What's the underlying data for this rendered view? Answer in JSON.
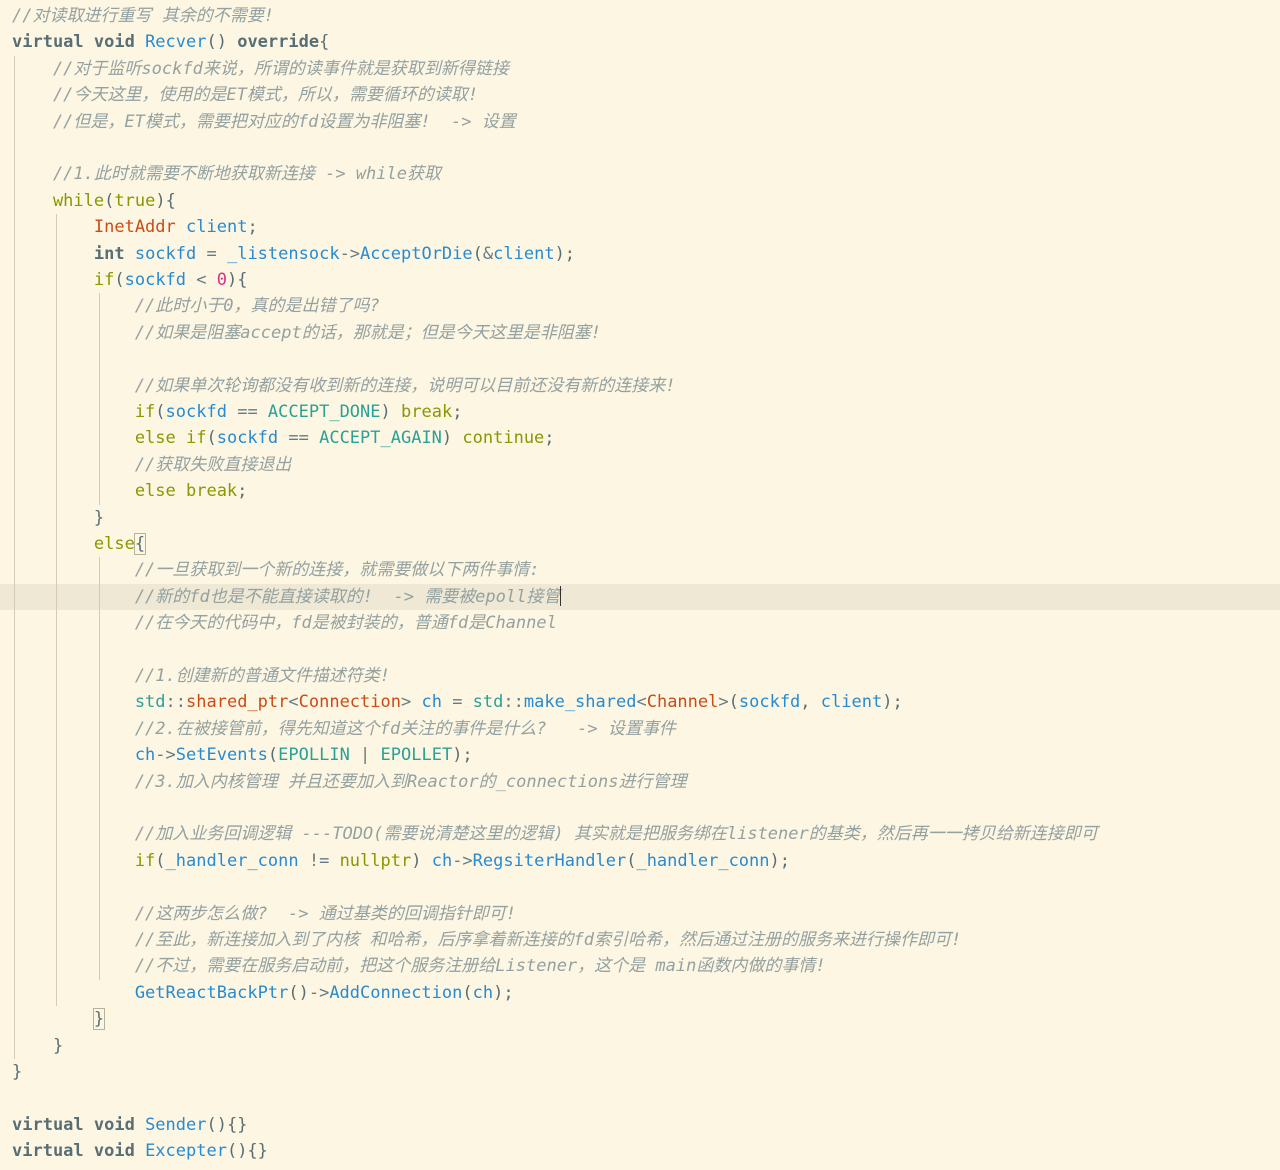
{
  "editor": {
    "lines": [
      [
        [
          "c",
          "//对读取进行重写 其余的不需要!"
        ]
      ],
      [
        [
          "kw",
          "virtual void "
        ],
        [
          "fn",
          "Recver"
        ],
        [
          "p",
          "() "
        ],
        [
          "kw",
          "override"
        ],
        [
          "p",
          "{"
        ]
      ],
      [
        [
          "c",
          "    //对于监听sockfd来说，所谓的读事件就是获取到新得链接"
        ]
      ],
      [
        [
          "c",
          "    //今天这里，使用的是ET模式，所以，需要循环的读取!"
        ]
      ],
      [
        [
          "c",
          "    //但是，ET模式，需要把对应的fd设置为非阻塞!  -> 设置"
        ]
      ],
      [],
      [
        [
          "c",
          "    //1.此时就需要不断地获取新连接 -> while获取"
        ]
      ],
      [
        [
          "fl",
          "    while"
        ],
        [
          "p",
          "("
        ],
        [
          "fl",
          "true"
        ],
        [
          "p",
          "){"
        ]
      ],
      [
        [
          "ty",
          "        InetAddr"
        ],
        [
          "op",
          " "
        ],
        [
          "vr",
          "client"
        ],
        [
          "p",
          ";"
        ]
      ],
      [
        [
          "kw",
          "        int "
        ],
        [
          "vr",
          "sockfd"
        ],
        [
          "op",
          " = "
        ],
        [
          "vr",
          "_listensock"
        ],
        [
          "op",
          "->"
        ],
        [
          "fn",
          "AcceptOrDie"
        ],
        [
          "p",
          "("
        ],
        [
          "op",
          "&"
        ],
        [
          "vr",
          "client"
        ],
        [
          "p",
          ");"
        ]
      ],
      [
        [
          "fl",
          "        if"
        ],
        [
          "p",
          "("
        ],
        [
          "vr",
          "sockfd"
        ],
        [
          "op",
          " < "
        ],
        [
          "nm",
          "0"
        ],
        [
          "p",
          "){"
        ]
      ],
      [
        [
          "c",
          "            //此时小于0，真的是出错了吗?"
        ]
      ],
      [
        [
          "c",
          "            //如果是阻塞accept的话，那就是；但是今天这里是非阻塞!"
        ]
      ],
      [],
      [
        [
          "c",
          "            //如果单次轮询都没有收到新的连接，说明可以目前还没有新的连接来!"
        ]
      ],
      [
        [
          "fl",
          "            if"
        ],
        [
          "p",
          "("
        ],
        [
          "vr",
          "sockfd"
        ],
        [
          "op",
          " == "
        ],
        [
          "cn",
          "ACCEPT_DONE"
        ],
        [
          "p",
          ") "
        ],
        [
          "fl",
          "break"
        ],
        [
          "p",
          ";"
        ]
      ],
      [
        [
          "fl",
          "            else if"
        ],
        [
          "p",
          "("
        ],
        [
          "vr",
          "sockfd"
        ],
        [
          "op",
          " == "
        ],
        [
          "cn",
          "ACCEPT_AGAIN"
        ],
        [
          "p",
          ") "
        ],
        [
          "fl",
          "continue"
        ],
        [
          "p",
          ";"
        ]
      ],
      [
        [
          "c",
          "            //获取失败直接退出"
        ]
      ],
      [
        [
          "fl",
          "            else break"
        ],
        [
          "p",
          ";"
        ]
      ],
      [
        [
          "p",
          "        }"
        ]
      ],
      [
        [
          "fl",
          "        else"
        ],
        [
          "box",
          "{"
        ]
      ],
      [
        [
          "c",
          "            //一旦获取到一个新的连接，就需要做以下两件事情:"
        ]
      ],
      [
        [
          "c",
          "            //新的fd也是不能直接读取的!  -> 需要被epoll接管"
        ],
        [
          "caret",
          ""
        ]
      ],
      [
        [
          "c",
          "            //在今天的代码中，fd是被封装的，普通fd是Channel"
        ]
      ],
      [],
      [
        [
          "c",
          "            //1.创建新的普通文件描述符类!"
        ]
      ],
      [
        [
          "cn",
          "            std"
        ],
        [
          "op",
          "::"
        ],
        [
          "ty",
          "shared_ptr"
        ],
        [
          "op",
          "<"
        ],
        [
          "ty",
          "Connection"
        ],
        [
          "op",
          "> "
        ],
        [
          "vr",
          "ch"
        ],
        [
          "op",
          " = "
        ],
        [
          "cn",
          "std"
        ],
        [
          "op",
          "::"
        ],
        [
          "fn",
          "make_shared"
        ],
        [
          "op",
          "<"
        ],
        [
          "ty",
          "Channel"
        ],
        [
          "op",
          ">"
        ],
        [
          "p",
          "("
        ],
        [
          "vr",
          "sockfd"
        ],
        [
          "p",
          ", "
        ],
        [
          "vr",
          "client"
        ],
        [
          "p",
          ");"
        ]
      ],
      [
        [
          "c",
          "            //2.在被接管前，得先知道这个fd关注的事件是什么?   -> 设置事件"
        ]
      ],
      [
        [
          "vr",
          "            ch"
        ],
        [
          "op",
          "->"
        ],
        [
          "fn",
          "SetEvents"
        ],
        [
          "p",
          "("
        ],
        [
          "cn",
          "EPOLLIN"
        ],
        [
          "op",
          " | "
        ],
        [
          "cn",
          "EPOLLET"
        ],
        [
          "p",
          ");"
        ]
      ],
      [
        [
          "c",
          "            //3.加入内核管理 并且还要加入到Reactor的_connections进行管理"
        ]
      ],
      [],
      [
        [
          "c",
          "            //加入业务回调逻辑 ---TODO(需要说清楚这里的逻辑) 其实就是把服务绑在listener的基类，然后再一一拷贝给新连接即可"
        ]
      ],
      [
        [
          "fl",
          "            if"
        ],
        [
          "p",
          "("
        ],
        [
          "vr",
          "_handler_conn"
        ],
        [
          "op",
          " != "
        ],
        [
          "fl",
          "nullptr"
        ],
        [
          "p",
          ") "
        ],
        [
          "vr",
          "ch"
        ],
        [
          "op",
          "->"
        ],
        [
          "fn",
          "RegsiterHandler"
        ],
        [
          "p",
          "("
        ],
        [
          "vr",
          "_handler_conn"
        ],
        [
          "p",
          ");"
        ]
      ],
      [],
      [
        [
          "c",
          "            //这两步怎么做?  -> 通过基类的回调指针即可!"
        ]
      ],
      [
        [
          "c",
          "            //至此，新连接加入到了内核 和哈希，后序拿着新连接的fd索引哈希，然后通过注册的服务来进行操作即可!"
        ]
      ],
      [
        [
          "c",
          "            //不过，需要在服务启动前，把这个服务注册给Listener，这个是 main函数内做的事情!"
        ]
      ],
      [
        [
          "fn",
          "            GetReactBackPtr"
        ],
        [
          "p",
          "()"
        ],
        [
          "op",
          "->"
        ],
        [
          "fn",
          "AddConnection"
        ],
        [
          "p",
          "("
        ],
        [
          "vr",
          "ch"
        ],
        [
          "p",
          ");"
        ]
      ],
      [
        [
          "box",
          "        }"
        ]
      ],
      [
        [
          "p",
          "    }"
        ]
      ],
      [
        [
          "p",
          "}"
        ]
      ],
      [],
      [
        [
          "kw",
          "virtual void "
        ],
        [
          "fn",
          "Sender"
        ],
        [
          "p",
          "(){}"
        ]
      ],
      [
        [
          "kw",
          "virtual void "
        ],
        [
          "fn",
          "Excepter"
        ],
        [
          "p",
          "(){}"
        ]
      ]
    ],
    "current_line": 22,
    "colors": {
      "background": "#fdf6e3",
      "current_line": "#eee8d5",
      "comment": "#93a1a1",
      "keyword": "#586e75",
      "flow": "#859900",
      "type": "#cb4b16",
      "function": "#268bd2",
      "constant": "#2aa198",
      "number": "#d33682"
    }
  }
}
